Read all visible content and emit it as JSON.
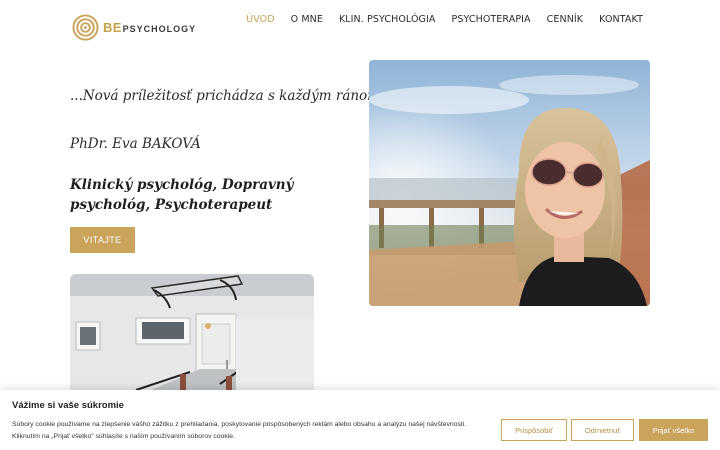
{
  "header": {
    "logo": {
      "be": "BE",
      "psychology": "PSYCHOLOGY"
    },
    "nav": [
      {
        "label": "ÚVOD",
        "active": true
      },
      {
        "label": "O MNE",
        "active": false
      },
      {
        "label": "KLIN. PSYCHOLÓGIA",
        "active": false
      },
      {
        "label": "PSYCHOTERAPIA",
        "active": false
      },
      {
        "label": "CENNÍK",
        "active": false
      },
      {
        "label": "KONTAKT",
        "active": false
      }
    ]
  },
  "hero": {
    "tagline": "...Nová príležitosť prichádza s každým ránom...",
    "name": "PhDr. Eva BAKOVÁ",
    "roles": "Klinický psychológ, Dopravný psychológ, Psychoterapeut",
    "cta_label": "VITAJTE"
  },
  "cookie_banner": {
    "title": "Vážime si vaše súkromie",
    "text": "Súbory cookie používame na zlepšenie vášho zážitku z prehliadania, poskytovanie prispôsobených reklám alebo obsahu a analýzu našej návštevnosti. Kliknutím na „Prijať všetko\" súhlasíte s naším používaním súborov cookie.",
    "customize_label": "Prispôsobiť",
    "reject_label": "Odmietnuť",
    "accept_label": "Prijať všetko"
  },
  "colors": {
    "accent": "#c9a45a",
    "text": "#222222"
  }
}
